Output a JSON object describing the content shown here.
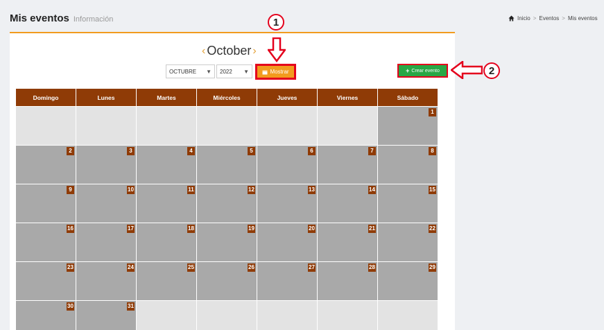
{
  "header": {
    "title": "Mis eventos",
    "subtitle": "Información"
  },
  "breadcrumb": {
    "home": "Inicio",
    "events": "Eventos",
    "current": "Mis eventos"
  },
  "calendar": {
    "month_title": "October",
    "prev_arrow": "‹",
    "next_arrow": "›",
    "month_select": "OCTUBRE",
    "year_select": "2022",
    "show_button": "Mostrar",
    "create_button": "Crear evento",
    "weekdays": [
      "Domingo",
      "Lunes",
      "Martes",
      "Miércoles",
      "Jueves",
      "Viernes",
      "Sábado"
    ],
    "weeks": [
      [
        "",
        "",
        "",
        "",
        "",
        "",
        "1"
      ],
      [
        "2",
        "3",
        "4",
        "5",
        "6",
        "7",
        "8"
      ],
      [
        "9",
        "10",
        "11",
        "12",
        "13",
        "14",
        "15"
      ],
      [
        "16",
        "17",
        "18",
        "19",
        "20",
        "21",
        "22"
      ],
      [
        "23",
        "24",
        "25",
        "26",
        "27",
        "28",
        "29"
      ],
      [
        "30",
        "31",
        "",
        "",
        "",
        "",
        ""
      ]
    ]
  },
  "callouts": [
    "1",
    "2"
  ],
  "colors": {
    "accent": "#f29b1e",
    "calendar_header": "#8f3b06",
    "create": "#28a745",
    "highlight": "#e4001c"
  }
}
